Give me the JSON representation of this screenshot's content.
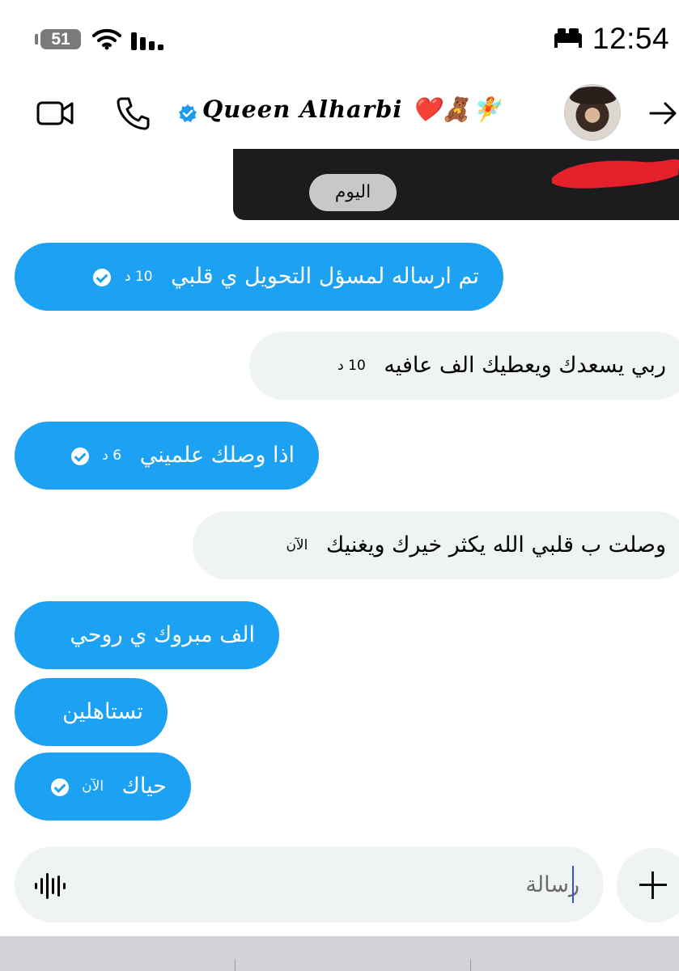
{
  "status_bar": {
    "battery_level": "51",
    "time": "12:54",
    "icons": [
      "battery-icon",
      "wifi-icon",
      "signal-icon",
      "sleep-mode-bed-icon"
    ]
  },
  "header": {
    "contact_name": "Queen Alharbi ❤️🧸🧚",
    "icons": [
      "video-call-icon",
      "phone-call-icon",
      "verified-badge-icon",
      "avatar",
      "forward-arrow-icon"
    ]
  },
  "story_card": {
    "day_label": "اليوم"
  },
  "colors": {
    "sent_bubble": "#1da1f2",
    "received_bubble": "#eff3f4",
    "composer": "#eff3f4"
  },
  "messages": [
    {
      "direction": "sent",
      "text": "تم ارساله لمسؤل التحويل ي قلبي",
      "time": "10 د",
      "read": true
    },
    {
      "direction": "received",
      "text": "ربي يسعدك ويعطيك الف عافيه",
      "time": "10 د"
    },
    {
      "direction": "sent",
      "text": "اذا وصلك علميني",
      "time": "6 د",
      "read": true
    },
    {
      "direction": "received",
      "text": "وصلت ب قلبي الله يكثر خيرك ويغنيك",
      "time": "الآن"
    },
    {
      "direction": "sent",
      "text": "الف مبروك ي روحي"
    },
    {
      "direction": "sent",
      "text": "تستاهلين"
    },
    {
      "direction": "sent",
      "text": "حياك",
      "time": "الآن",
      "read": true
    }
  ],
  "composer": {
    "placeholder": "رسالة",
    "icons": [
      "voice-message-icon",
      "plus-icon"
    ]
  }
}
